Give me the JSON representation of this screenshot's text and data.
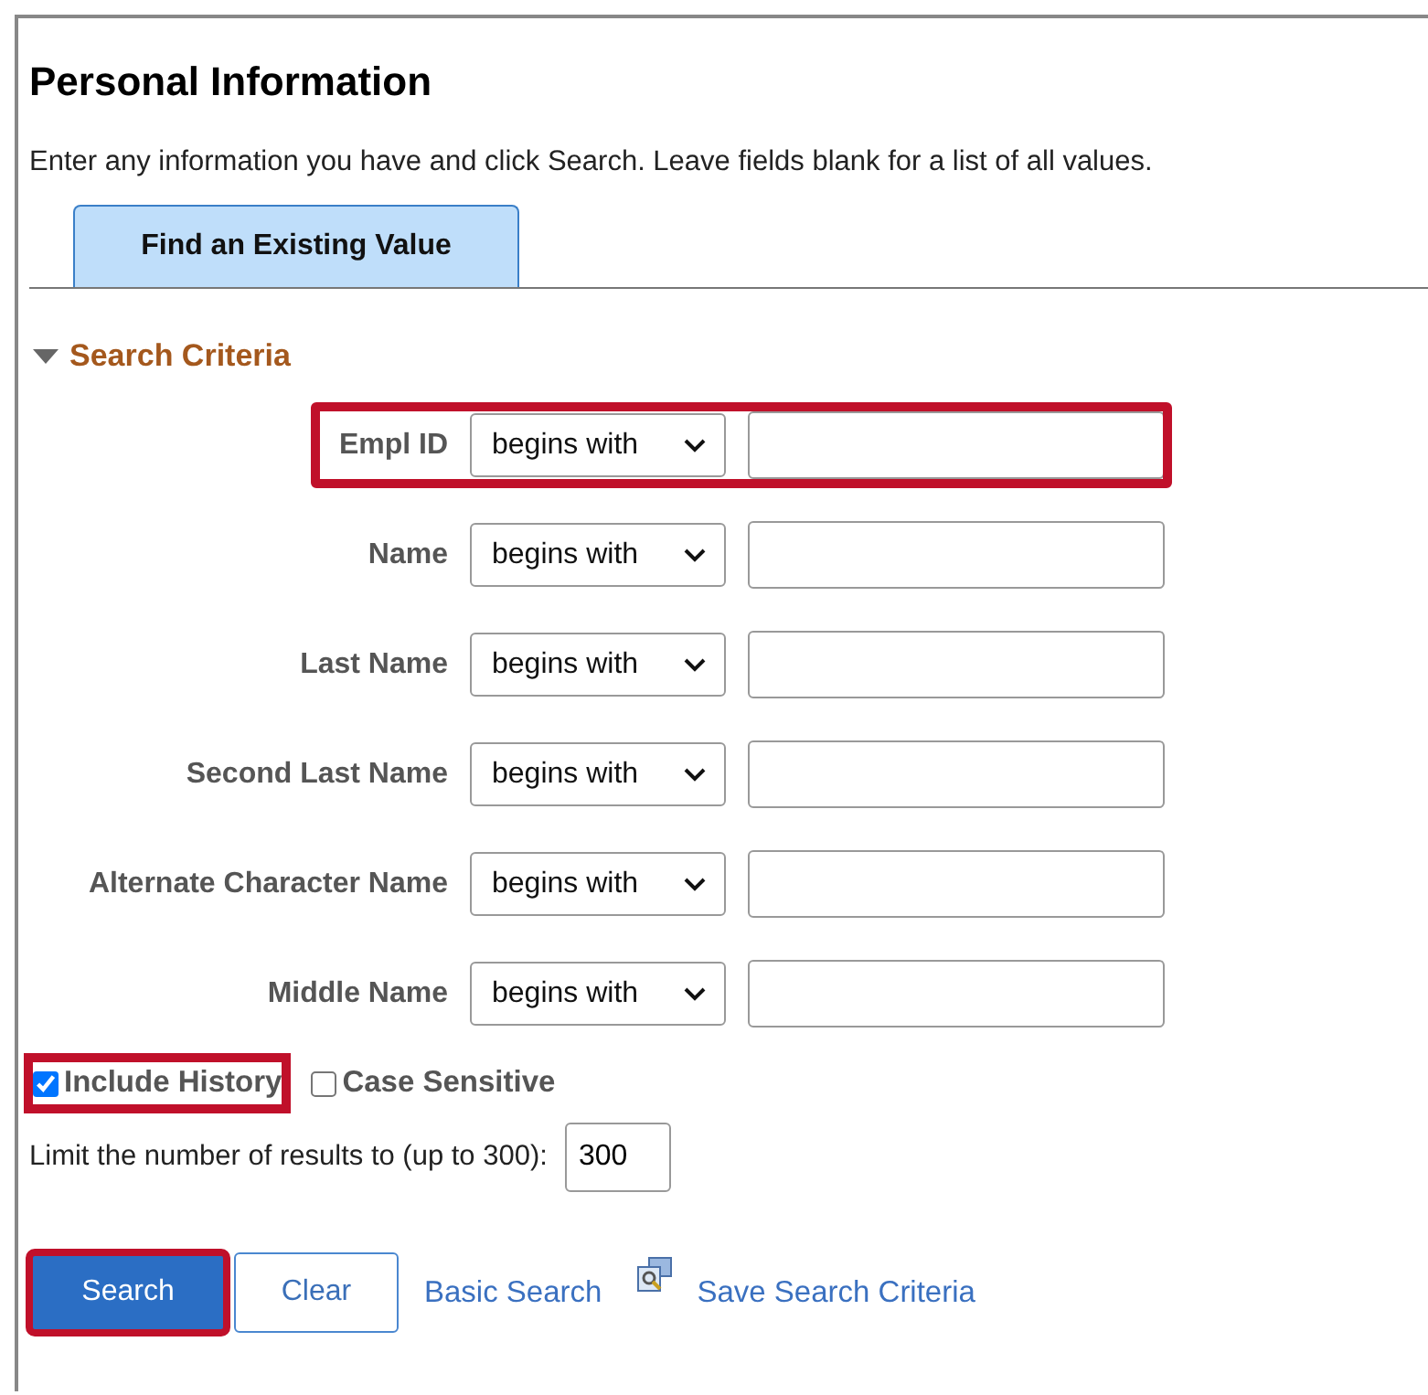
{
  "title": "Personal Information",
  "instructions": "Enter any information you have and click Search. Leave fields blank for a list of all values.",
  "tabs": [
    {
      "label": "Find an Existing Value",
      "selected": true
    }
  ],
  "section": {
    "label": "Search Criteria",
    "expanded": true
  },
  "fields": [
    {
      "label": "Empl ID",
      "operator": "begins with",
      "highlighted": true
    },
    {
      "label": "Name",
      "operator": "begins with",
      "highlighted": false
    },
    {
      "label": "Last Name",
      "operator": "begins with",
      "highlighted": false
    },
    {
      "label": "Second Last Name",
      "operator": "begins with",
      "highlighted": false
    },
    {
      "label": "Alternate Character Name",
      "operator": "begins with",
      "highlighted": false
    },
    {
      "label": "Middle Name",
      "operator": "begins with",
      "highlighted": false
    }
  ],
  "options": [
    {
      "label": "Include History",
      "checked": true,
      "highlighted": true
    },
    {
      "label": "Case Sensitive",
      "checked": false,
      "highlighted": false
    }
  ],
  "limit": {
    "label": "Limit the number of results to (up to 300):",
    "value": "300"
  },
  "buttons": [
    {
      "label": "Search",
      "kind": "primary",
      "highlighted": true
    },
    {
      "label": "Clear",
      "kind": "secondary",
      "highlighted": false
    }
  ],
  "links": [
    {
      "label": "Basic Search",
      "kind": "plain"
    },
    {
      "label": "Save Search Criteria",
      "kind": "save"
    }
  ]
}
